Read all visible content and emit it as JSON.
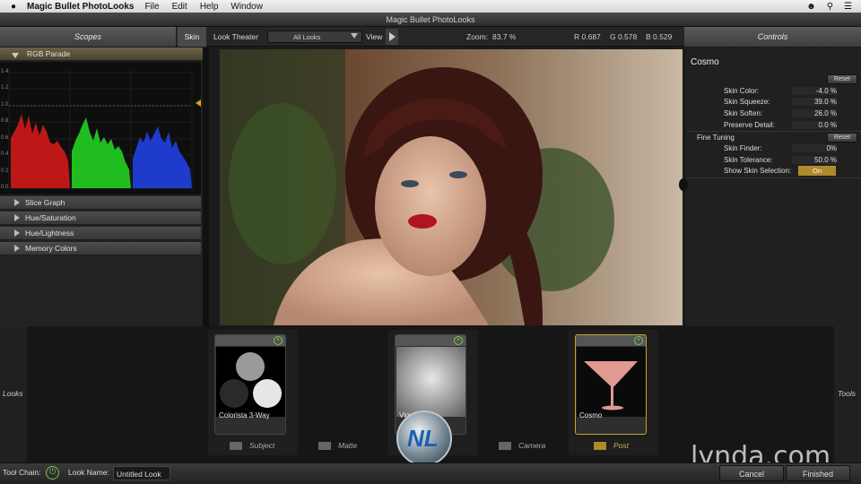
{
  "menubar": {
    "apple": "",
    "app_name": "Magic Bullet PhotoLooks",
    "items": [
      "File",
      "Edit",
      "Help",
      "Window"
    ]
  },
  "window_title": "Magic Bullet PhotoLooks",
  "header": {
    "scopes_label": "Scopes",
    "skin_tab": "Skin",
    "look_theater": "Look Theater",
    "looks_dropdown": "All Looks",
    "view_label": "View",
    "zoom_label": "Zoom:",
    "zoom_value": "83.7 %",
    "r_value": "R 0.687",
    "g_value": "G 0.578",
    "b_value": "B 0.529",
    "controls_label": "Controls"
  },
  "scopes": {
    "expanded": "RGB Parade",
    "y_ticks": [
      "1.4",
      "1.2",
      "1.0",
      "0.8",
      "0.6",
      "0.4",
      "0.2",
      "0.0"
    ],
    "collapsed": [
      "Slice Graph",
      "Hue/Saturation",
      "Hue/Lightness",
      "Memory Colors"
    ]
  },
  "controls": {
    "tool_name": "Cosmo",
    "reset": "Reset",
    "params": [
      {
        "label": "Skin Color:",
        "value": "-4.0 %"
      },
      {
        "label": "Skin Squeeze:",
        "value": "39.0 %"
      },
      {
        "label": "Skin Soften:",
        "value": "26.0 %"
      },
      {
        "label": "Preserve Detail:",
        "value": "0.0 %"
      }
    ],
    "fine_tuning": "Fine Tuning",
    "fine_reset": "Reset",
    "fine_params": [
      {
        "label": "Skin Finder:",
        "value": "0%"
      },
      {
        "label": "Skin Tolerance:",
        "value": "50.0 %"
      }
    ],
    "show_skin_label": "Show Skin Selection:",
    "show_skin_value": "On"
  },
  "toolchain": {
    "looks_tab": "Looks",
    "tools_tab": "Tools",
    "cards": [
      {
        "name": "Colorista 3-Way"
      },
      {
        "name": "Vignette"
      },
      {
        "name": "Cosmo"
      }
    ],
    "categories": [
      "Subject",
      "Matte",
      "Camera",
      "Post"
    ]
  },
  "footer": {
    "tool_chain_label": "Tool Chain:",
    "look_name_label": "Look Name:",
    "look_name_value": "Untitled Look",
    "cancel": "Cancel",
    "finished": "Finished"
  },
  "watermark": "lynda.com",
  "colors": {
    "accent": "#c9a030",
    "power": "#7ec24a",
    "panel": "#222222"
  }
}
